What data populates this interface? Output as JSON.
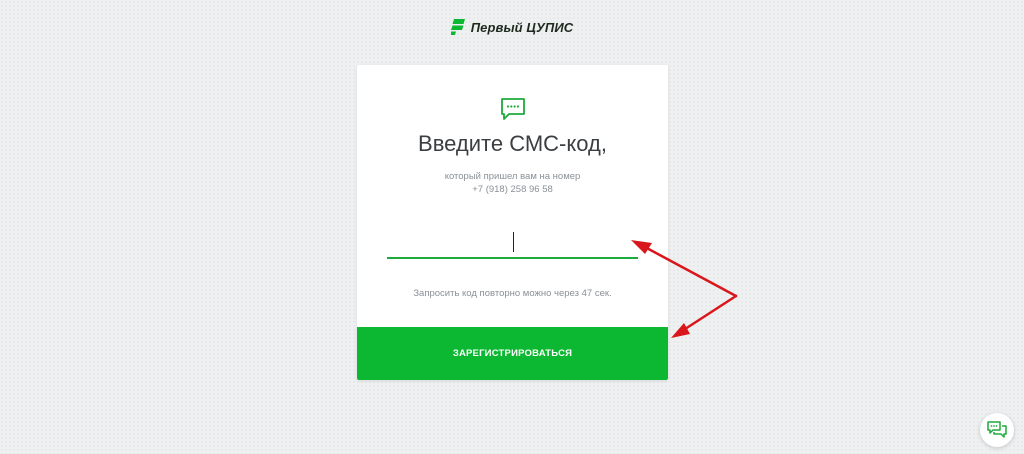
{
  "brand": {
    "name": "Первый ЦУПИС",
    "logo_icon": "cupis-logo-icon",
    "accent_color": "#0cb832"
  },
  "card": {
    "icon": "sms-chat-icon",
    "title": "Введите СМС-код,",
    "subtitle_line1": "который пришел вам на номер",
    "phone": "+7 (918) 258 96 58",
    "code_input": {
      "value": "",
      "placeholder": ""
    },
    "resend_text": "Запросить код повторно можно через 47 сек.",
    "submit_label": "ЗАРЕГИСТРИРОВАТЬСЯ"
  },
  "support": {
    "icon": "chat-bubbles-icon"
  },
  "annotation": {
    "arrow_color": "#d9161b"
  }
}
